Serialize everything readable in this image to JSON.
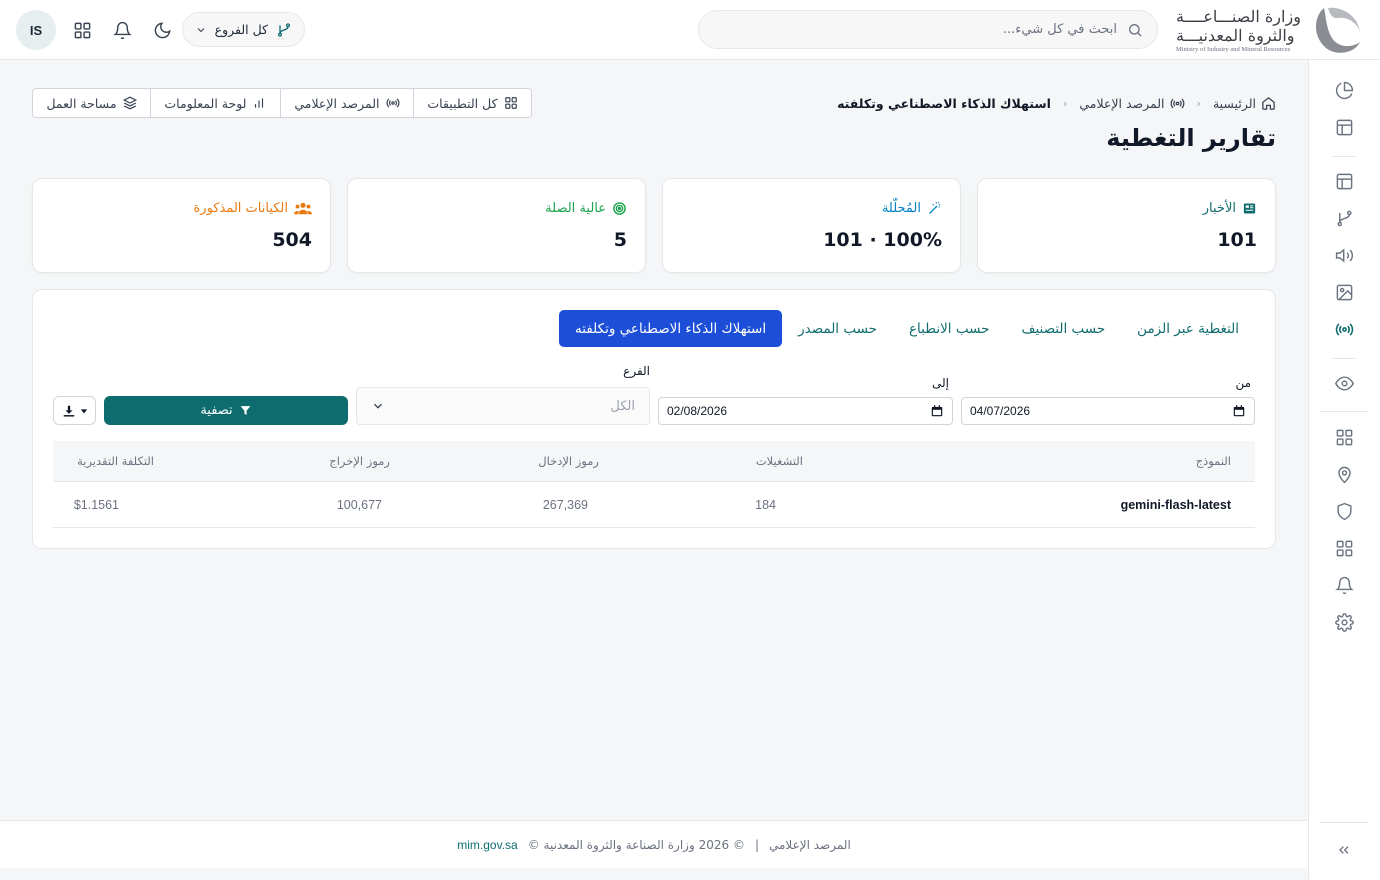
{
  "header": {
    "logo_line1": "وزارة الصنـــاعــــة",
    "logo_line2": "والثروة المعدنيـــة",
    "logo_line3": "Ministry of Industry and Mineral Resources",
    "search_placeholder": "ابحث في كل شيء...",
    "branch_label": "كل الفروع",
    "user_initials": "IS"
  },
  "breadcrumb": {
    "home": "الرئيسية",
    "section": "المرصد الإعلامي",
    "current": "استهلاك الذكاء الاصطناعي وتكلفته"
  },
  "page_title": "تقارير التغطية",
  "quick_links": [
    {
      "label": "كل التطبيقات",
      "icon": "grid-icon"
    },
    {
      "label": "المرصد الإعلامي",
      "icon": "broadcast-icon"
    },
    {
      "label": "لوحة المعلومات",
      "icon": "bar-chart-icon"
    },
    {
      "label": "مساحة العمل",
      "icon": "layers-icon"
    }
  ],
  "stats": [
    {
      "label": "الأخبار",
      "value": "101",
      "color": "#0f6c6e",
      "icon": "newspaper-icon"
    },
    {
      "label": "المُحلّلة",
      "value": "101 · 100%",
      "color": "#0284c7",
      "icon": "magic-wand-icon"
    },
    {
      "label": "عالية الصلة",
      "value": "5",
      "color": "#16a34a",
      "icon": "target-icon"
    },
    {
      "label": "الكيانات المذكورة",
      "value": "504",
      "color": "#ea7a10",
      "icon": "users-icon"
    }
  ],
  "tabs": [
    {
      "label": "التغطية عبر الزمن",
      "active": false
    },
    {
      "label": "حسب التصنيف",
      "active": false
    },
    {
      "label": "حسب الانطباع",
      "active": false
    },
    {
      "label": "حسب المصدر",
      "active": false
    },
    {
      "label": "استهلاك الذكاء الاصطناعي وتكلفته",
      "active": true
    }
  ],
  "filters": {
    "from_label": "من",
    "from_value": "04/07/2026",
    "to_label": "إلى",
    "to_value": "02/08/2026",
    "branch_label": "الفرع",
    "branch_value": "الكل",
    "filter_button": "تصفية"
  },
  "table": {
    "columns": [
      "النموذج",
      "التشغيلات",
      "رموز الإدخال",
      "رموز الإخراج",
      "التكلفة التقديرية"
    ],
    "rows": [
      [
        "gemini-flash-latest",
        "184",
        "267,369",
        "100,677",
        "$1.1561"
      ]
    ]
  },
  "footer": {
    "app_name": "المرصد الإعلامي",
    "separator": "|",
    "copyright": "© 2026 وزارة الصناعة والثروة المعدنية ©",
    "site": "mim.gov.sa"
  },
  "colors": {
    "primary_teal": "#0f6c6e",
    "active_tab_blue": "#1d4ed8"
  }
}
